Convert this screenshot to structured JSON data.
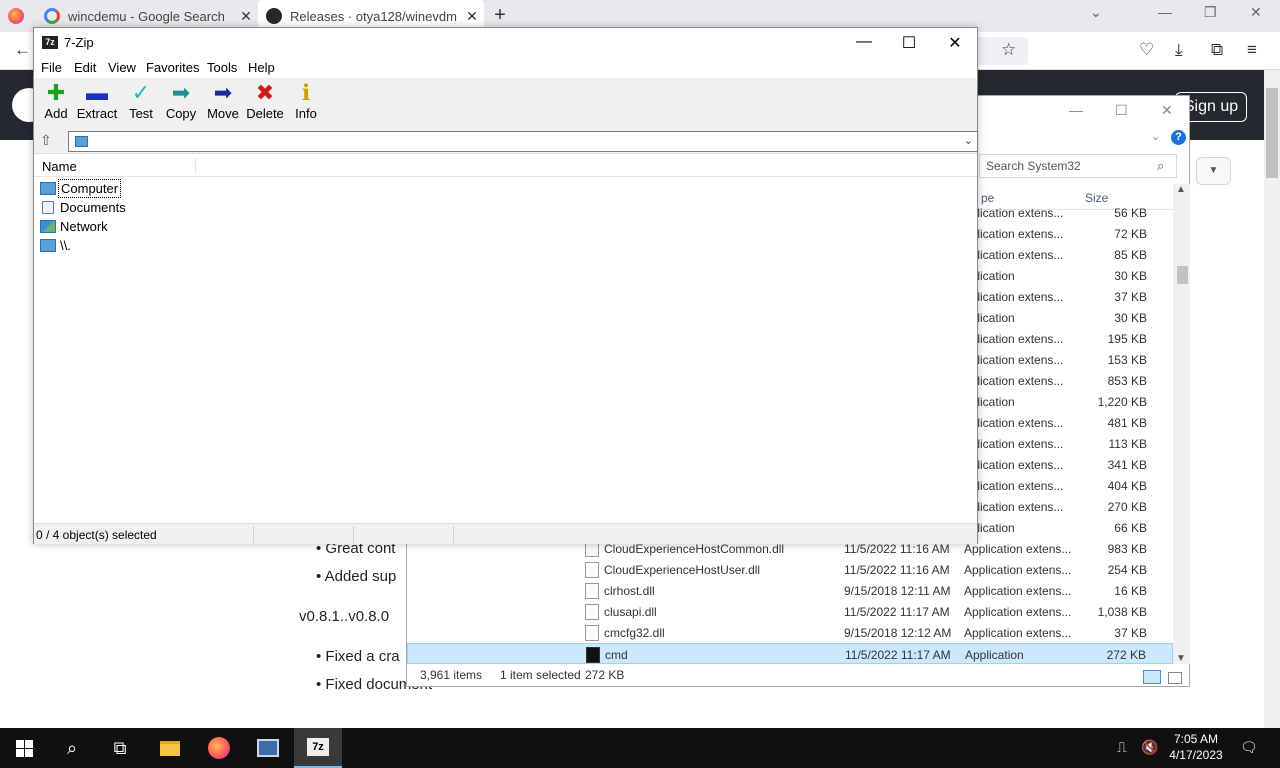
{
  "browser": {
    "tabs": [
      {
        "title": "wincdemu - Google Search",
        "favicon": "google-icon"
      },
      {
        "title": "Releases · otya128/winevdm",
        "favicon": "github-icon"
      }
    ]
  },
  "github": {
    "signup_label": "Sign up",
    "bullets_top": [
      "Great cont",
      "Added sup"
    ],
    "version_text": "v0.8.1..v0.8.0",
    "bullets_bottom": [
      "Fixed a cra",
      "Fixed document"
    ]
  },
  "explorer": {
    "search_placeholder": "Search System32",
    "col_type": "pe",
    "col_size": "Size",
    "rows": [
      {
        "name": "",
        "date": "",
        "type": "pplication extens...",
        "size": "56 KB"
      },
      {
        "name": "",
        "date": "",
        "type": "pplication extens...",
        "size": "72 KB"
      },
      {
        "name": "",
        "date": "",
        "type": "pplication extens...",
        "size": "85 KB"
      },
      {
        "name": "",
        "date": "",
        "type": "pplication",
        "size": "30 KB"
      },
      {
        "name": "",
        "date": "",
        "type": "pplication extens...",
        "size": "37 KB"
      },
      {
        "name": "",
        "date": "",
        "type": "pplication",
        "size": "30 KB"
      },
      {
        "name": "",
        "date": "",
        "type": "pplication extens...",
        "size": "195 KB"
      },
      {
        "name": "",
        "date": "",
        "type": "pplication extens...",
        "size": "153 KB"
      },
      {
        "name": "",
        "date": "",
        "type": "pplication extens...",
        "size": "853 KB"
      },
      {
        "name": "",
        "date": "",
        "type": "pplication",
        "size": "1,220 KB"
      },
      {
        "name": "",
        "date": "",
        "type": "pplication extens...",
        "size": "481 KB"
      },
      {
        "name": "",
        "date": "",
        "type": "pplication extens...",
        "size": "113 KB"
      },
      {
        "name": "",
        "date": "",
        "type": "pplication extens...",
        "size": "341 KB"
      },
      {
        "name": "",
        "date": "",
        "type": "pplication extens...",
        "size": "404 KB"
      },
      {
        "name": "",
        "date": "",
        "type": "pplication extens...",
        "size": "270 KB"
      },
      {
        "name": "",
        "date": "",
        "type": "pplication",
        "size": "66 KB"
      },
      {
        "name": "CloudExperienceHostCommon.dll",
        "date": "11/5/2022 11:16 AM",
        "type": "Application extens...",
        "size": "983 KB"
      },
      {
        "name": "CloudExperienceHostUser.dll",
        "date": "11/5/2022 11:16 AM",
        "type": "Application extens...",
        "size": "254 KB"
      },
      {
        "name": "clrhost.dll",
        "date": "9/15/2018 12:11 AM",
        "type": "Application extens...",
        "size": "16 KB"
      },
      {
        "name": "clusapi.dll",
        "date": "11/5/2022 11:17 AM",
        "type": "Application extens...",
        "size": "1,038 KB"
      },
      {
        "name": "cmcfg32.dll",
        "date": "9/15/2018 12:12 AM",
        "type": "Application extens...",
        "size": "37 KB"
      },
      {
        "name": "cmd",
        "date": "11/5/2022 11:17 AM",
        "type": "Application",
        "size": "272 KB",
        "selected": true
      }
    ],
    "status": {
      "items": "3,961 items",
      "selected": "1 item selected",
      "size": "272 KB"
    }
  },
  "sevenzip": {
    "title": "7-Zip",
    "menu": [
      "File",
      "Edit",
      "View",
      "Favorites",
      "Tools",
      "Help"
    ],
    "toolbar": [
      {
        "label": "Add",
        "icon": "add-icon",
        "glyph": "✚",
        "color": "#1aa31a"
      },
      {
        "label": "Extract",
        "icon": "extract-icon",
        "glyph": "▬",
        "color": "#1a2ccc"
      },
      {
        "label": "Test",
        "icon": "test-icon",
        "glyph": "✓",
        "color": "#2ab0d0"
      },
      {
        "label": "Copy",
        "icon": "copy-icon",
        "glyph": "➡",
        "color": "#1e8f8f"
      },
      {
        "label": "Move",
        "icon": "move-icon",
        "glyph": "➡",
        "color": "#1a2a99"
      },
      {
        "label": "Delete",
        "icon": "delete-icon",
        "glyph": "✖",
        "color": "#d11a1a"
      },
      {
        "label": "Info",
        "icon": "info-icon",
        "glyph": "ℹ",
        "color": "#c8a000"
      }
    ],
    "column_name": "Name",
    "items": [
      {
        "label": "Computer",
        "icon": "computer-icon"
      },
      {
        "label": "Documents",
        "icon": "documents-icon"
      },
      {
        "label": "Network",
        "icon": "network-icon"
      },
      {
        "label": "\\\\.",
        "icon": "drive-icon"
      }
    ],
    "status": "0 / 4 object(s) selected"
  },
  "taskbar": {
    "time": "7:05 AM",
    "date": "4/17/2023"
  }
}
